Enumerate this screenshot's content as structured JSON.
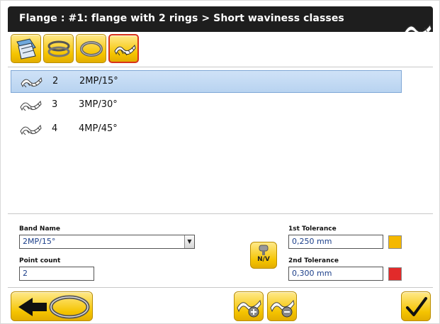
{
  "window": {
    "title": "Flange : #1: flange with 2 rings > Short waviness classes",
    "title_icon": "waviness-icon"
  },
  "toolbar": {
    "buttons": [
      {
        "icon": "flange-drawing-icon"
      },
      {
        "icon": "ring-pair-icon"
      },
      {
        "icon": "single-ring-icon"
      },
      {
        "icon": "waviness-icon",
        "active": true
      }
    ]
  },
  "list": {
    "items": [
      {
        "number": "2",
        "label": "2MP/15°",
        "selected": true
      },
      {
        "number": "3",
        "label": "3MP/30°",
        "selected": false
      },
      {
        "number": "4",
        "label": "4MP/45°",
        "selected": false
      }
    ]
  },
  "form": {
    "band_name_label": "Band Name",
    "band_name_value": "2MP/15°",
    "point_count_label": "Point count",
    "point_count_value": "2",
    "nv_label": "N/V",
    "tolerance1_label": "1st Tolerance",
    "tolerance1_value": "0,250 mm",
    "tolerance1_color": "#f5b800",
    "tolerance2_label": "2nd Tolerance",
    "tolerance2_value": "0,300 mm",
    "tolerance2_color": "#e22a2a"
  },
  "bottom": {
    "back_icon": "back-arrow-icon",
    "add_icon": "add-waviness-icon",
    "remove_icon": "remove-waviness-icon",
    "confirm_icon": "checkmark-icon"
  },
  "colors": {
    "accent_yellow": "#f5c400",
    "selection_blue": "#b8d3f0",
    "titlebar": "#1e1e1e"
  }
}
